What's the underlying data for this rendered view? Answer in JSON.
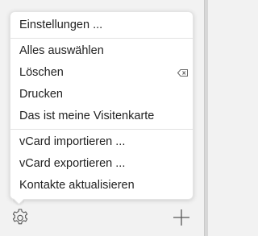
{
  "menu": {
    "items": [
      {
        "label": "Einstellungen ..."
      },
      {
        "label": "Alles auswählen"
      },
      {
        "label": "Löschen",
        "shortcut_icon": "delete-key-icon"
      },
      {
        "label": "Drucken"
      },
      {
        "label": "Das ist meine Visitenkarte"
      },
      {
        "label": "vCard importieren ..."
      },
      {
        "label": "vCard exportieren ..."
      },
      {
        "label": "Kontakte aktualisieren"
      }
    ]
  },
  "toolbar": {
    "left_icon": "gear-icon",
    "right_icon": "plus-icon"
  },
  "colors": {
    "menu_bg": "#ffffff",
    "bar_bg": "#f2f2f2",
    "icon": "#555555",
    "separator": "#e2e2e2"
  }
}
